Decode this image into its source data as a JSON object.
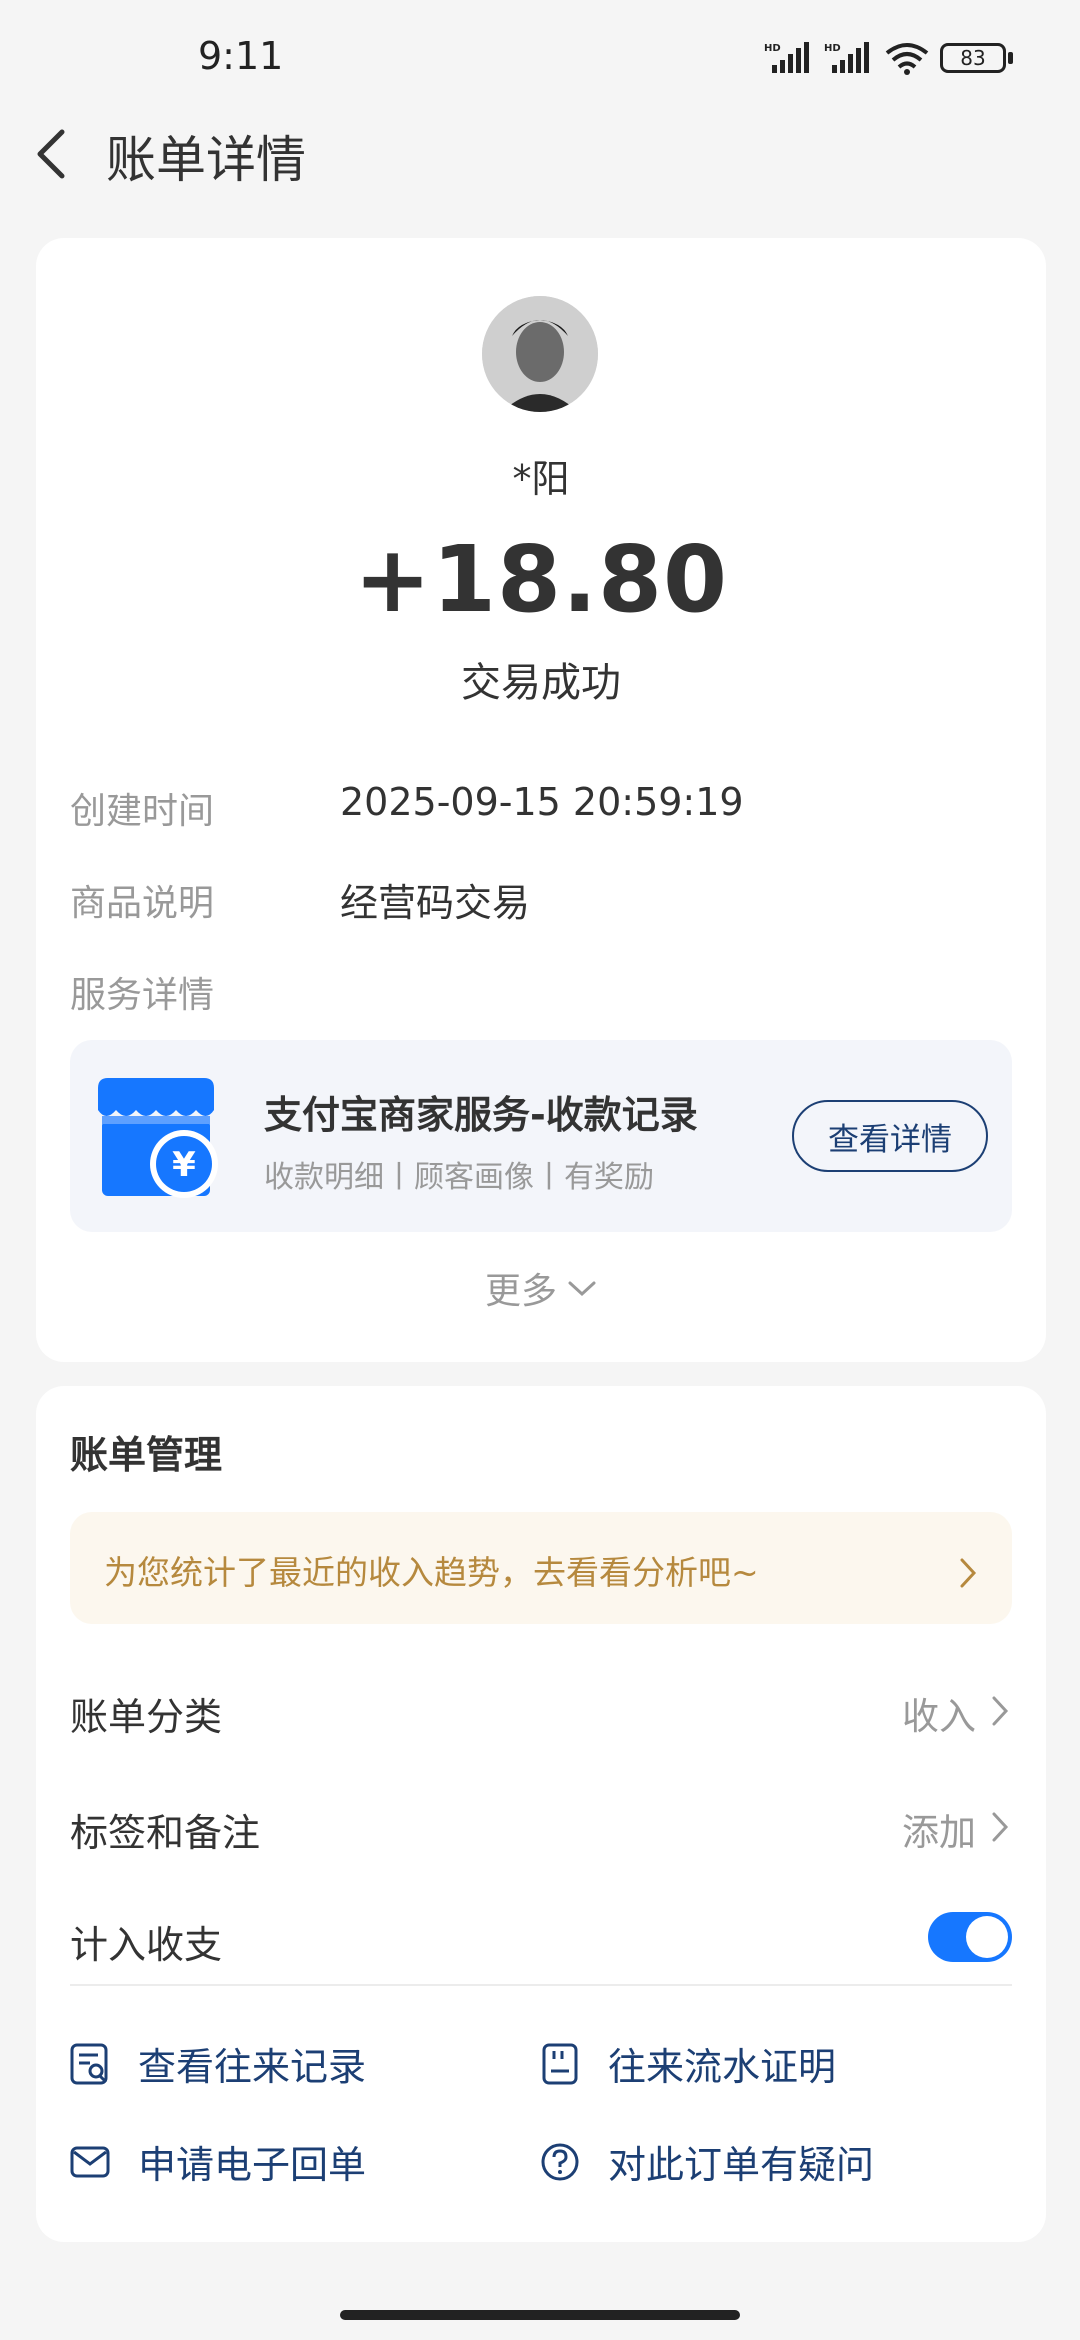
{
  "status_bar": {
    "time": "9:11",
    "battery": "83"
  },
  "header": {
    "title": "账单详情"
  },
  "transaction": {
    "payer": "*阳",
    "amount": "+18.80",
    "status": "交易成功",
    "fields": [
      {
        "label": "创建时间",
        "value": "2025-09-15 20:59:19"
      },
      {
        "label": "商品说明",
        "value": "经营码交易"
      }
    ],
    "service_label": "服务详情"
  },
  "service_card": {
    "title": "支付宝商家服务-收款记录",
    "subtitle": "收款明细丨顾客画像丨有奖励",
    "button": "查看详情"
  },
  "more": "更多",
  "bill_management": {
    "title": "账单管理",
    "banner": "为您统计了最近的收入趋势，去看看分析吧~",
    "rows": [
      {
        "label": "账单分类",
        "value": "收入"
      },
      {
        "label": "标签和备注",
        "value": "添加"
      },
      {
        "label": "计入收支",
        "toggle_on": true
      }
    ],
    "links": [
      {
        "label": "查看往来记录",
        "icon": "records-icon"
      },
      {
        "label": "往来流水证明",
        "icon": "document-icon"
      },
      {
        "label": "申请电子回单",
        "icon": "mail-icon"
      },
      {
        "label": "对此订单有疑问",
        "icon": "question-icon"
      }
    ]
  },
  "colors": {
    "accent": "#1677ff",
    "link": "#1c3f74",
    "banner_text": "#b6893e"
  }
}
